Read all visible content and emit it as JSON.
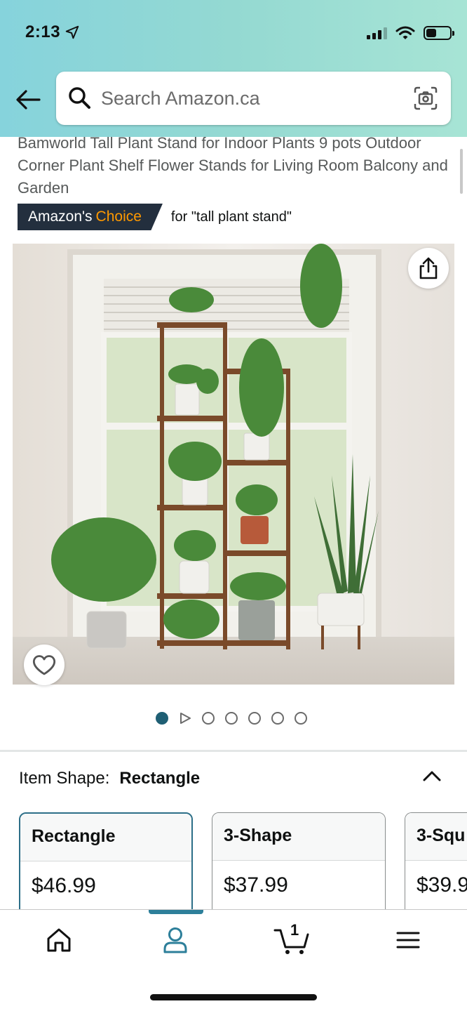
{
  "status_bar": {
    "time": "2:13"
  },
  "search": {
    "placeholder": "Search Amazon.ca"
  },
  "product": {
    "title": "Bamworld Tall Plant Stand for Indoor Plants 9 pots Outdoor Corner Plant Shelf Flower Stands for Living Room Balcony and Garden",
    "badge_prefix": "Amazon's",
    "badge_highlight": "Choice",
    "badge_for": "for \"tall plant stand\""
  },
  "gallery": {
    "image_count": 7,
    "active_index": 0,
    "video_index": 1
  },
  "shape": {
    "label": "Item Shape:",
    "selected": "Rectangle",
    "options": [
      {
        "name": "Rectangle",
        "price": "$46.99"
      },
      {
        "name": "3-Shape",
        "price": "$37.99"
      },
      {
        "name": "3-Squ",
        "price": "$39.9"
      }
    ]
  },
  "nav": {
    "cart_count": "1",
    "active": "account"
  },
  "colors": {
    "accent": "#2d7f9a",
    "badge_bg": "#232f3e",
    "badge_orange": "#ff9900"
  }
}
